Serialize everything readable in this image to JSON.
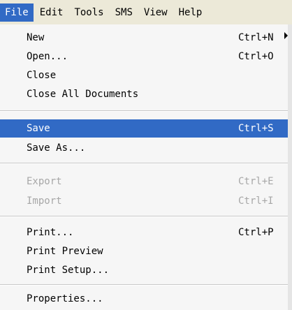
{
  "menubar": {
    "items": [
      {
        "label": "File"
      },
      {
        "label": "Edit"
      },
      {
        "label": "Tools"
      },
      {
        "label": "SMS"
      },
      {
        "label": "View"
      },
      {
        "label": "Help"
      }
    ],
    "active": "File"
  },
  "file_menu": {
    "new": {
      "label": "New",
      "shortcut": "Ctrl+N"
    },
    "open": {
      "label": "Open...",
      "shortcut": "Ctrl+O"
    },
    "close": {
      "label": "Close"
    },
    "close_all": {
      "label": "Close All Documents"
    },
    "save": {
      "label": "Save",
      "shortcut": "Ctrl+S"
    },
    "save_as": {
      "label": "Save As..."
    },
    "export": {
      "label": "Export",
      "shortcut": "Ctrl+E"
    },
    "import": {
      "label": "Import",
      "shortcut": "Ctrl+I"
    },
    "print": {
      "label": "Print...",
      "shortcut": "Ctrl+P"
    },
    "print_preview": {
      "label": "Print Preview"
    },
    "print_setup": {
      "label": "Print Setup..."
    },
    "properties": {
      "label": "Properties..."
    }
  },
  "colors": {
    "highlight": "#316ac5",
    "disabled_text": "#a7a7a7"
  }
}
